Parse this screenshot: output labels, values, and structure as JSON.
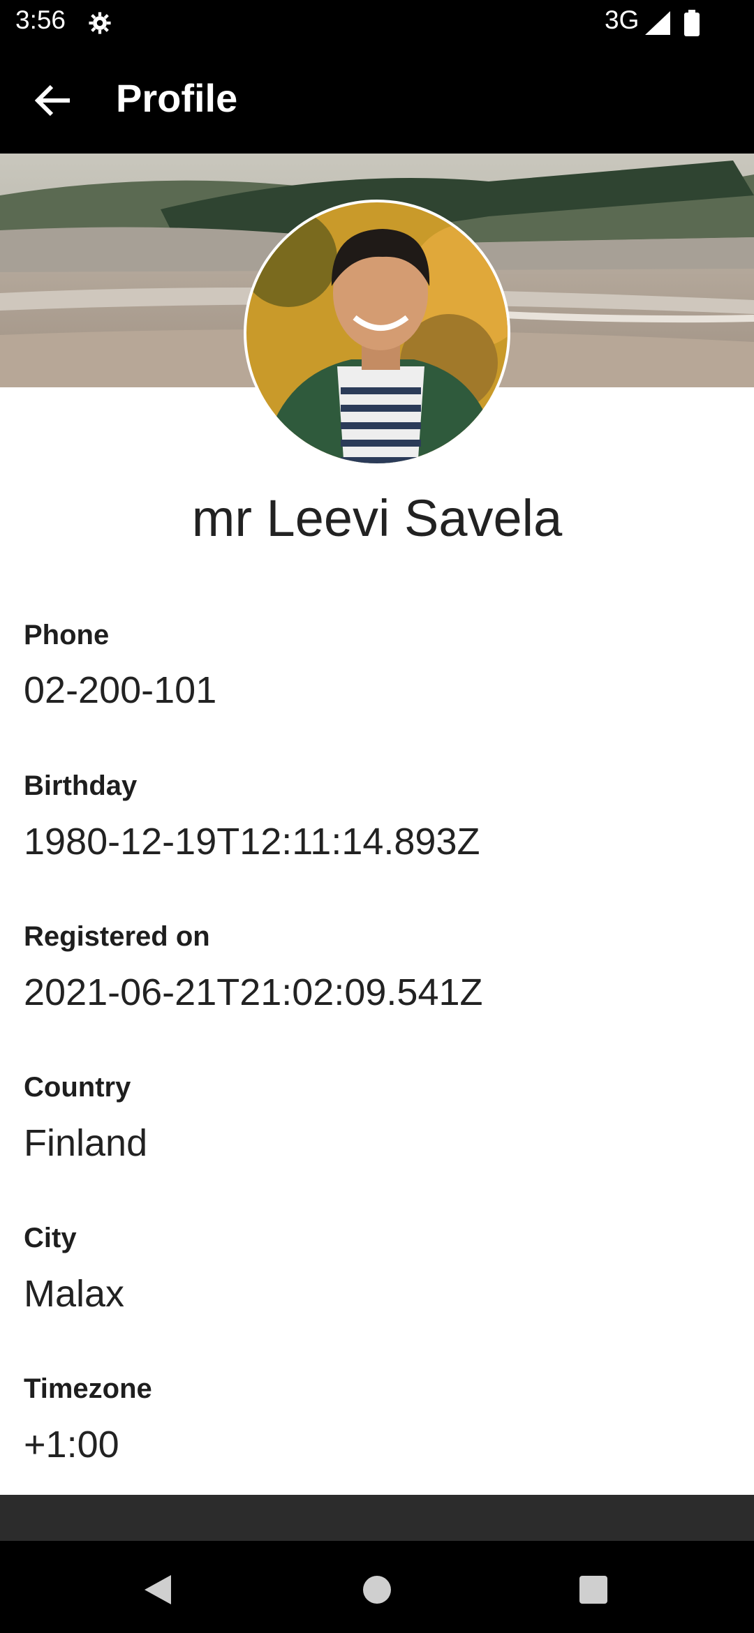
{
  "status_bar": {
    "time": "3:56",
    "network": "3G",
    "icons": [
      "settings-gear-icon",
      "signal-icon",
      "battery-icon"
    ]
  },
  "app_bar": {
    "title": "Profile",
    "back_icon": "arrow-back-icon"
  },
  "profile": {
    "name": "mr Leevi Savela",
    "fields": [
      {
        "label": "Phone",
        "value": "02-200-101"
      },
      {
        "label": "Birthday",
        "value": "1980-12-19T12:11:14.893Z"
      },
      {
        "label": "Registered on",
        "value": "2021-06-21T21:02:09.541Z"
      },
      {
        "label": "Country",
        "value": "Finland"
      },
      {
        "label": "City",
        "value": "Malax"
      },
      {
        "label": "Timezone",
        "value": "+1:00"
      }
    ]
  },
  "nav_bar": {
    "icons": [
      "back-triangle-icon",
      "home-circle-icon",
      "recents-square-icon"
    ]
  },
  "colors": {
    "app_bar_bg": "#000000",
    "content_bg": "#ffffff",
    "text_primary": "#222222"
  }
}
